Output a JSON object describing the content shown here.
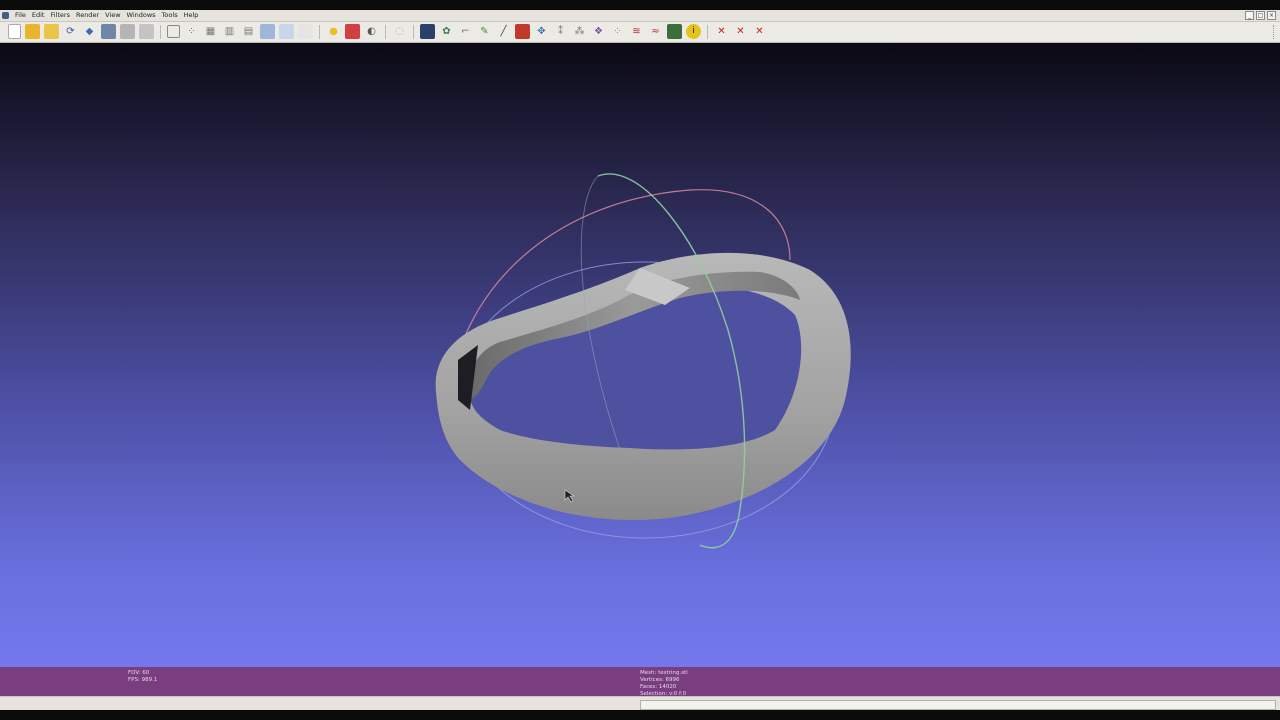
{
  "window": {
    "minimize": "_",
    "maximize": "□",
    "close": "×"
  },
  "menu": [
    "File",
    "Edit",
    "Filters",
    "Render",
    "View",
    "Windows",
    "Tools",
    "Help"
  ],
  "toolbar": {
    "icons": [
      "new-project-icon",
      "open-project-icon",
      "open-mesh-icon",
      "reload-icon",
      "save-icon",
      "snapshot-icon",
      "layers-icon",
      "print-icon",
      "bbox-icon",
      "points-icon",
      "wireframe-icon",
      "hidden-lines-icon",
      "flat-lines-icon",
      "flat-icon",
      "smooth-icon",
      "texture-icon",
      "light-icon",
      "double-side-icon",
      "fancy-light-icon",
      "color-per-face-icon",
      "shader-icon",
      "measure-icon",
      "paint-icon",
      "brush-icon",
      "pick-points-icon",
      "align-icon",
      "move-icon",
      "select-faces-icon",
      "select-vertices-icon",
      "select-connected-icon",
      "edit-icon",
      "rasterize-icon",
      "info-icon",
      "delete-faces-icon",
      "delete-vertices-icon",
      "delete-selection-icon"
    ]
  },
  "status": {
    "left": {
      "fov": "FOV: 60",
      "fps": "FPS:  989.1"
    },
    "right": {
      "mesh": "Mesh: testring.stl",
      "vertices": "Vertices: 6996",
      "faces": "Faces: 14020",
      "selection": "Selection: v:0 f:0"
    }
  },
  "colors": {
    "status_bar": "#7a3d7f",
    "trackball_red": "#d98aa0",
    "trackball_green": "#8fd0a0",
    "trackball_blue": "#9aa0e8",
    "mesh": "#a8a8a8"
  }
}
